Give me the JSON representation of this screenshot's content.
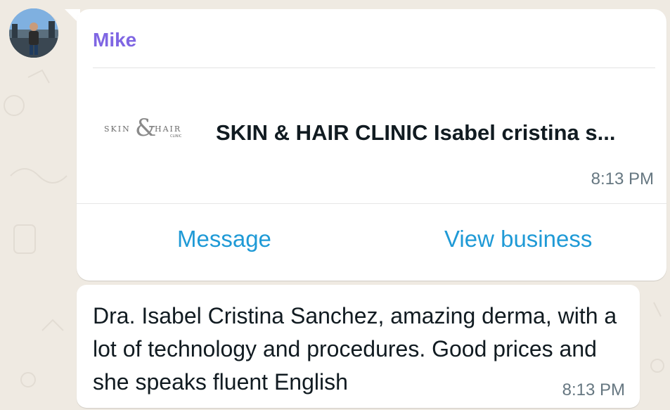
{
  "chat": {
    "card": {
      "sender_name": "Mike",
      "logo_text": "SKIN & HAIR CLINIC",
      "business_title": "SKIN & HAIR CLINIC Isabel cristina s...",
      "time": "8:13 PM",
      "actions": [
        {
          "label": "Message"
        },
        {
          "label": "View business"
        }
      ]
    },
    "message": {
      "text": "Dra. Isabel Cristina Sanchez, amazing derma, with a lot of technology and procedures. Good prices and she speaks fluent English",
      "time": "8:13 PM"
    }
  },
  "colors": {
    "sender": "#7f66e3",
    "link": "#1f9ad6",
    "timestamp": "#667781",
    "background": "#efeae2"
  },
  "icons": [
    "avatar-photo",
    "clinic-logo"
  ]
}
